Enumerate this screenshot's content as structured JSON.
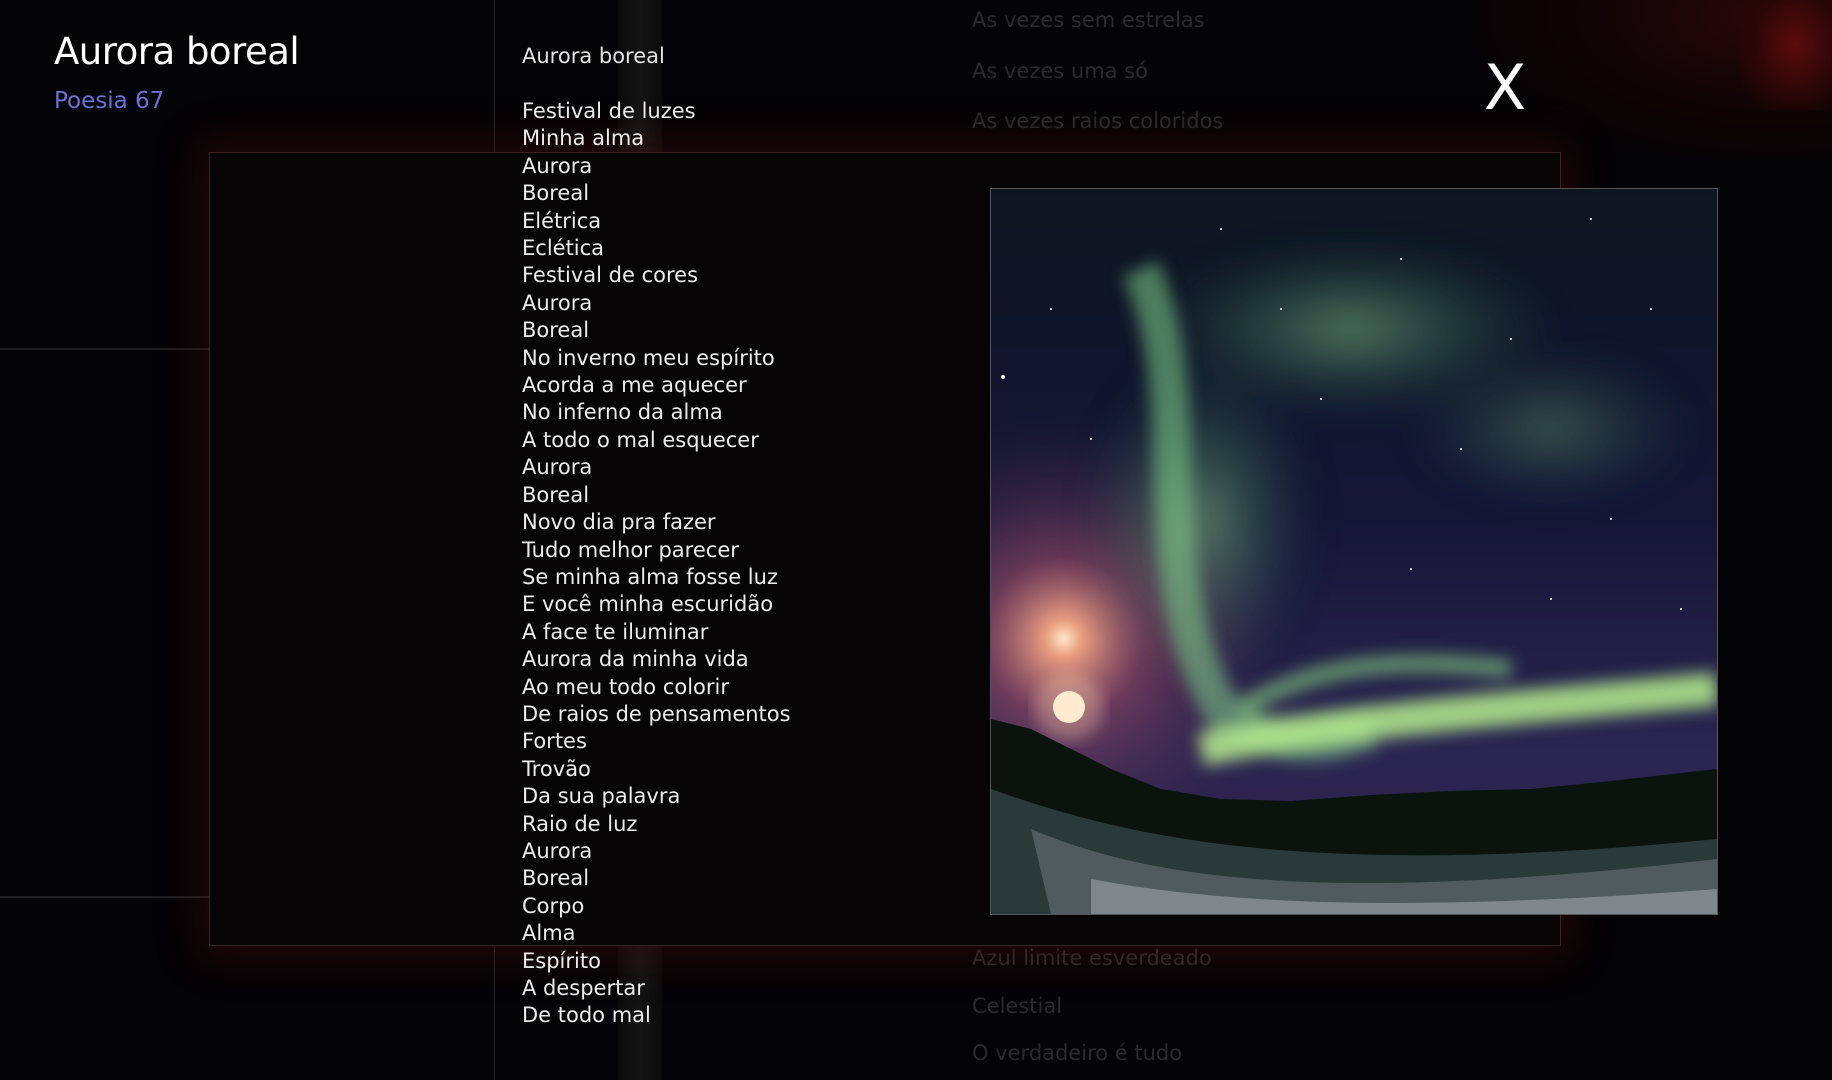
{
  "header": {
    "title": "Aurora boreal",
    "subtitle": "Poesia 67"
  },
  "close_button_label": "X",
  "background_text": {
    "top": [
      "As vezes sem estrelas",
      "As vezes uma só",
      "As vezes raios coloridos"
    ],
    "bottom": [
      "Azul limite esverdeado",
      "Celestial",
      "O verdadeiro é tudo"
    ]
  },
  "poem": {
    "title": "Aurora boreal",
    "lines": [
      "Festival de luzes",
      "Minha alma",
      "Aurora",
      "Boreal",
      "Elétrica",
      "Eclética",
      "Festival de cores",
      "Aurora",
      "Boreal",
      "No inverno meu espírito",
      "Acorda a me aquecer",
      "No inferno da alma",
      "A todo o mal esquecer",
      "Aurora",
      "Boreal",
      "Novo dia pra fazer",
      "Tudo melhor parecer",
      "Se minha alma fosse luz",
      "E você minha escuridão",
      "A face te iluminar",
      "Aurora da minha vida",
      "Ao meu todo colorir",
      "De raios de pensamentos",
      "Fortes",
      "Trovão",
      "Da sua palavra",
      "Raio de luz",
      "Aurora",
      "Boreal",
      "Corpo",
      "Alma",
      "Espírito",
      "A despertar",
      "De todo mal"
    ]
  },
  "colors": {
    "background": "#040305",
    "subtitle": "#6e70d9",
    "aurora_green": "#8ee08a",
    "modal_glow": "#6e1212"
  }
}
